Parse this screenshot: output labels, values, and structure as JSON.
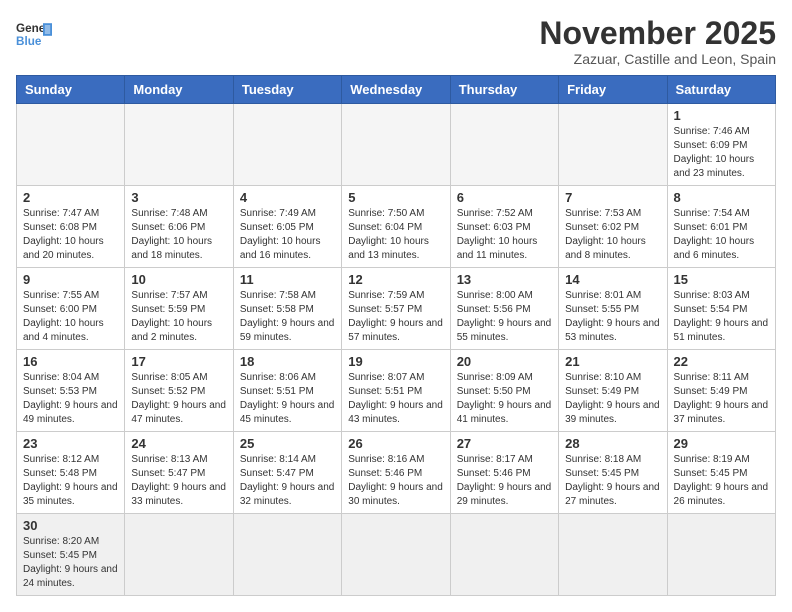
{
  "logo": {
    "text_general": "General",
    "text_blue": "Blue"
  },
  "header": {
    "month": "November 2025",
    "location": "Zazuar, Castille and Leon, Spain"
  },
  "weekdays": [
    "Sunday",
    "Monday",
    "Tuesday",
    "Wednesday",
    "Thursday",
    "Friday",
    "Saturday"
  ],
  "weeks": [
    [
      {
        "day": "",
        "info": ""
      },
      {
        "day": "",
        "info": ""
      },
      {
        "day": "",
        "info": ""
      },
      {
        "day": "",
        "info": ""
      },
      {
        "day": "",
        "info": ""
      },
      {
        "day": "",
        "info": ""
      },
      {
        "day": "1",
        "info": "Sunrise: 7:46 AM\nSunset: 6:09 PM\nDaylight: 10 hours and 23 minutes."
      }
    ],
    [
      {
        "day": "2",
        "info": "Sunrise: 7:47 AM\nSunset: 6:08 PM\nDaylight: 10 hours and 20 minutes."
      },
      {
        "day": "3",
        "info": "Sunrise: 7:48 AM\nSunset: 6:06 PM\nDaylight: 10 hours and 18 minutes."
      },
      {
        "day": "4",
        "info": "Sunrise: 7:49 AM\nSunset: 6:05 PM\nDaylight: 10 hours and 16 minutes."
      },
      {
        "day": "5",
        "info": "Sunrise: 7:50 AM\nSunset: 6:04 PM\nDaylight: 10 hours and 13 minutes."
      },
      {
        "day": "6",
        "info": "Sunrise: 7:52 AM\nSunset: 6:03 PM\nDaylight: 10 hours and 11 minutes."
      },
      {
        "day": "7",
        "info": "Sunrise: 7:53 AM\nSunset: 6:02 PM\nDaylight: 10 hours and 8 minutes."
      },
      {
        "day": "8",
        "info": "Sunrise: 7:54 AM\nSunset: 6:01 PM\nDaylight: 10 hours and 6 minutes."
      }
    ],
    [
      {
        "day": "9",
        "info": "Sunrise: 7:55 AM\nSunset: 6:00 PM\nDaylight: 10 hours and 4 minutes."
      },
      {
        "day": "10",
        "info": "Sunrise: 7:57 AM\nSunset: 5:59 PM\nDaylight: 10 hours and 2 minutes."
      },
      {
        "day": "11",
        "info": "Sunrise: 7:58 AM\nSunset: 5:58 PM\nDaylight: 9 hours and 59 minutes."
      },
      {
        "day": "12",
        "info": "Sunrise: 7:59 AM\nSunset: 5:57 PM\nDaylight: 9 hours and 57 minutes."
      },
      {
        "day": "13",
        "info": "Sunrise: 8:00 AM\nSunset: 5:56 PM\nDaylight: 9 hours and 55 minutes."
      },
      {
        "day": "14",
        "info": "Sunrise: 8:01 AM\nSunset: 5:55 PM\nDaylight: 9 hours and 53 minutes."
      },
      {
        "day": "15",
        "info": "Sunrise: 8:03 AM\nSunset: 5:54 PM\nDaylight: 9 hours and 51 minutes."
      }
    ],
    [
      {
        "day": "16",
        "info": "Sunrise: 8:04 AM\nSunset: 5:53 PM\nDaylight: 9 hours and 49 minutes."
      },
      {
        "day": "17",
        "info": "Sunrise: 8:05 AM\nSunset: 5:52 PM\nDaylight: 9 hours and 47 minutes."
      },
      {
        "day": "18",
        "info": "Sunrise: 8:06 AM\nSunset: 5:51 PM\nDaylight: 9 hours and 45 minutes."
      },
      {
        "day": "19",
        "info": "Sunrise: 8:07 AM\nSunset: 5:51 PM\nDaylight: 9 hours and 43 minutes."
      },
      {
        "day": "20",
        "info": "Sunrise: 8:09 AM\nSunset: 5:50 PM\nDaylight: 9 hours and 41 minutes."
      },
      {
        "day": "21",
        "info": "Sunrise: 8:10 AM\nSunset: 5:49 PM\nDaylight: 9 hours and 39 minutes."
      },
      {
        "day": "22",
        "info": "Sunrise: 8:11 AM\nSunset: 5:49 PM\nDaylight: 9 hours and 37 minutes."
      }
    ],
    [
      {
        "day": "23",
        "info": "Sunrise: 8:12 AM\nSunset: 5:48 PM\nDaylight: 9 hours and 35 minutes."
      },
      {
        "day": "24",
        "info": "Sunrise: 8:13 AM\nSunset: 5:47 PM\nDaylight: 9 hours and 33 minutes."
      },
      {
        "day": "25",
        "info": "Sunrise: 8:14 AM\nSunset: 5:47 PM\nDaylight: 9 hours and 32 minutes."
      },
      {
        "day": "26",
        "info": "Sunrise: 8:16 AM\nSunset: 5:46 PM\nDaylight: 9 hours and 30 minutes."
      },
      {
        "day": "27",
        "info": "Sunrise: 8:17 AM\nSunset: 5:46 PM\nDaylight: 9 hours and 29 minutes."
      },
      {
        "day": "28",
        "info": "Sunrise: 8:18 AM\nSunset: 5:45 PM\nDaylight: 9 hours and 27 minutes."
      },
      {
        "day": "29",
        "info": "Sunrise: 8:19 AM\nSunset: 5:45 PM\nDaylight: 9 hours and 26 minutes."
      }
    ],
    [
      {
        "day": "30",
        "info": "Sunrise: 8:20 AM\nSunset: 5:45 PM\nDaylight: 9 hours and 24 minutes."
      },
      {
        "day": "",
        "info": ""
      },
      {
        "day": "",
        "info": ""
      },
      {
        "day": "",
        "info": ""
      },
      {
        "day": "",
        "info": ""
      },
      {
        "day": "",
        "info": ""
      },
      {
        "day": "",
        "info": ""
      }
    ]
  ]
}
